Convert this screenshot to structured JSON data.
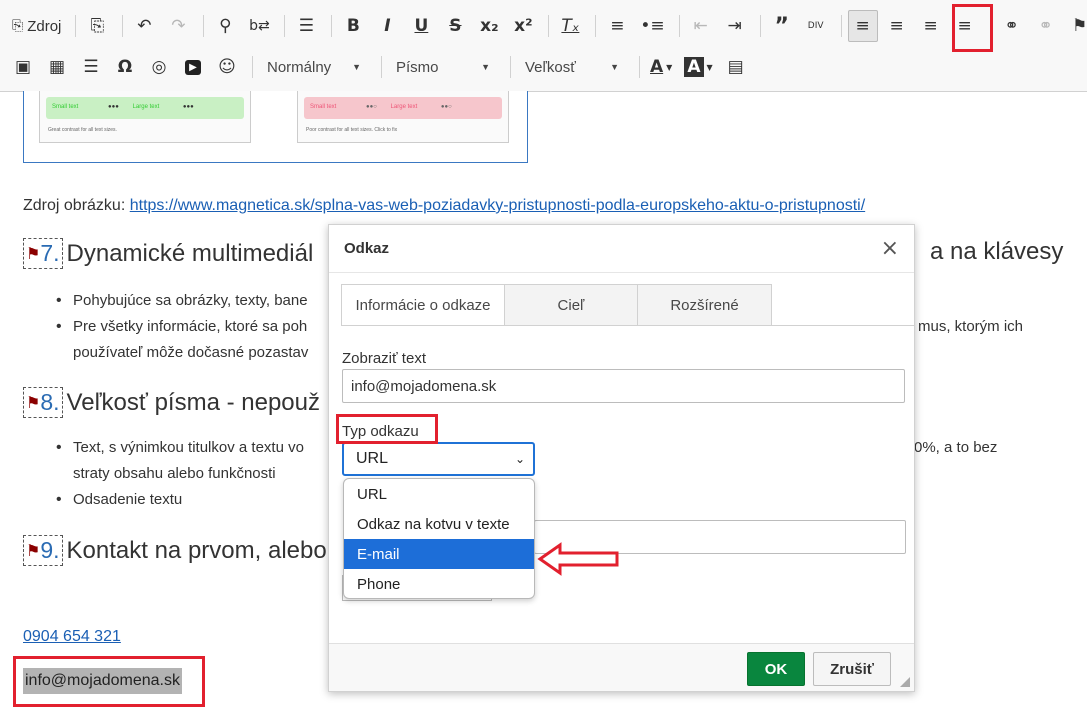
{
  "toolbar": {
    "source_label": "Zdroj",
    "row1": [
      {
        "icon": "source-icon",
        "glyph": "⎙"
      },
      {
        "icon": "paste-icon",
        "glyph": "⎘"
      },
      {
        "icon": "undo-icon",
        "glyph": "↶"
      },
      {
        "icon": "redo-icon",
        "glyph": "↷"
      },
      {
        "icon": "find-icon",
        "glyph": "⌕"
      },
      {
        "icon": "replace-icon",
        "glyph": "⇄"
      },
      {
        "icon": "select-all-icon",
        "glyph": "☰"
      },
      {
        "icon": "bold-icon",
        "glyph": "B"
      },
      {
        "icon": "italic-icon",
        "glyph": "I"
      },
      {
        "icon": "underline-icon",
        "glyph": "U"
      },
      {
        "icon": "strike-icon",
        "glyph": "S"
      },
      {
        "icon": "subscript-icon",
        "glyph": "x₂"
      },
      {
        "icon": "superscript-icon",
        "glyph": "x²"
      },
      {
        "icon": "remove-format-icon",
        "glyph": "Tₓ"
      },
      {
        "icon": "numbered-list-icon",
        "glyph": "≡"
      },
      {
        "icon": "bulleted-list-icon",
        "glyph": "•≡"
      },
      {
        "icon": "outdent-icon",
        "glyph": "⇤"
      },
      {
        "icon": "indent-icon",
        "glyph": "⇥"
      },
      {
        "icon": "blockquote-icon",
        "glyph": "”"
      },
      {
        "icon": "div-icon",
        "glyph": "DIV"
      },
      {
        "icon": "align-left-icon",
        "glyph": "≡"
      },
      {
        "icon": "align-center-icon",
        "glyph": "≡"
      },
      {
        "icon": "align-right-icon",
        "glyph": "≡"
      },
      {
        "icon": "justify-icon",
        "glyph": "≡"
      },
      {
        "icon": "link-icon",
        "glyph": "⚭"
      },
      {
        "icon": "unlink-icon",
        "glyph": "⚭"
      },
      {
        "icon": "anchor-flag-icon",
        "glyph": "⚑"
      }
    ],
    "row2": [
      {
        "icon": "image-icon",
        "glyph": "▣"
      },
      {
        "icon": "table-icon",
        "glyph": "▦"
      },
      {
        "icon": "horizontal-line-icon",
        "glyph": "☰"
      },
      {
        "icon": "special-char-icon",
        "glyph": "Ω"
      },
      {
        "icon": "iframe-globe-icon",
        "glyph": "◎"
      },
      {
        "icon": "youtube-icon",
        "glyph": "▶"
      },
      {
        "icon": "smiley-icon",
        "glyph": "☺"
      }
    ],
    "format_label": "Normálny",
    "font_label": "Písmo",
    "size_label": "Veľkosť",
    "text_color_glyph": "A",
    "bg_color_glyph": "A",
    "show_blocks_glyph": "▤"
  },
  "content": {
    "thumb_left": {
      "small": "Small text",
      "large": "Large text",
      "caption": "Great contrast for all text sizes."
    },
    "thumb_right": {
      "small": "Small text",
      "large": "Large text",
      "caption": "Poor contrast for all text sizes. Click to fix"
    },
    "source_prefix": "Zdroj obrázku:",
    "source_link": "https://www.magnetica.sk/splna-vas-web-poziadavky-pristupnosti-podla-europskeho-aktu-o-pristupnosti/",
    "h7_num": "7.",
    "h7_text": "Dynamické multimediál",
    "h7_tail": "a na klávesy",
    "b7_1": "Pohybujúce sa obrázky, texty, bane",
    "b7_2": "Pre všetky informácie, ktoré sa poh",
    "b7_2_tail": "mus, ktorým ich",
    "b7_3": "používateľ môže dočasné pozastav",
    "h8_num": "8.",
    "h8_text": "Veľkosť písma - nepouž",
    "b8_1": "Text, s výnimkou titulkov a textu vo",
    "b8_1_tail": "0%, a to bez",
    "b8_2": "straty obsahu alebo funkčnosti",
    "b8_3": "Odsadenie textu",
    "h9_num": "9.",
    "h9_text": "Kontakt na prvom, alebo",
    "phone": "0904 654 321",
    "email": "info@mojadomena.sk"
  },
  "dialog": {
    "title": "Odkaz",
    "close_glyph": "×",
    "tabs": [
      "Informácie o odkaze",
      "Cieľ",
      "Rozšírené"
    ],
    "display_text_label": "Zobraziť text",
    "display_text_value": "info@mojadomena.sk",
    "link_type_label": "Typ odkazu",
    "link_type_value": "URL",
    "options": [
      "URL",
      "Odkaz na kotvu v texte",
      "E-mail",
      "Phone"
    ],
    "selected_option": "E-mail",
    "ok_label": "OK",
    "cancel_label": "Zrušiť"
  },
  "colors": {
    "highlight": "#e2202e",
    "ok": "#09863e",
    "selected": "#1d6ed8",
    "link": "#1a5fb4"
  }
}
